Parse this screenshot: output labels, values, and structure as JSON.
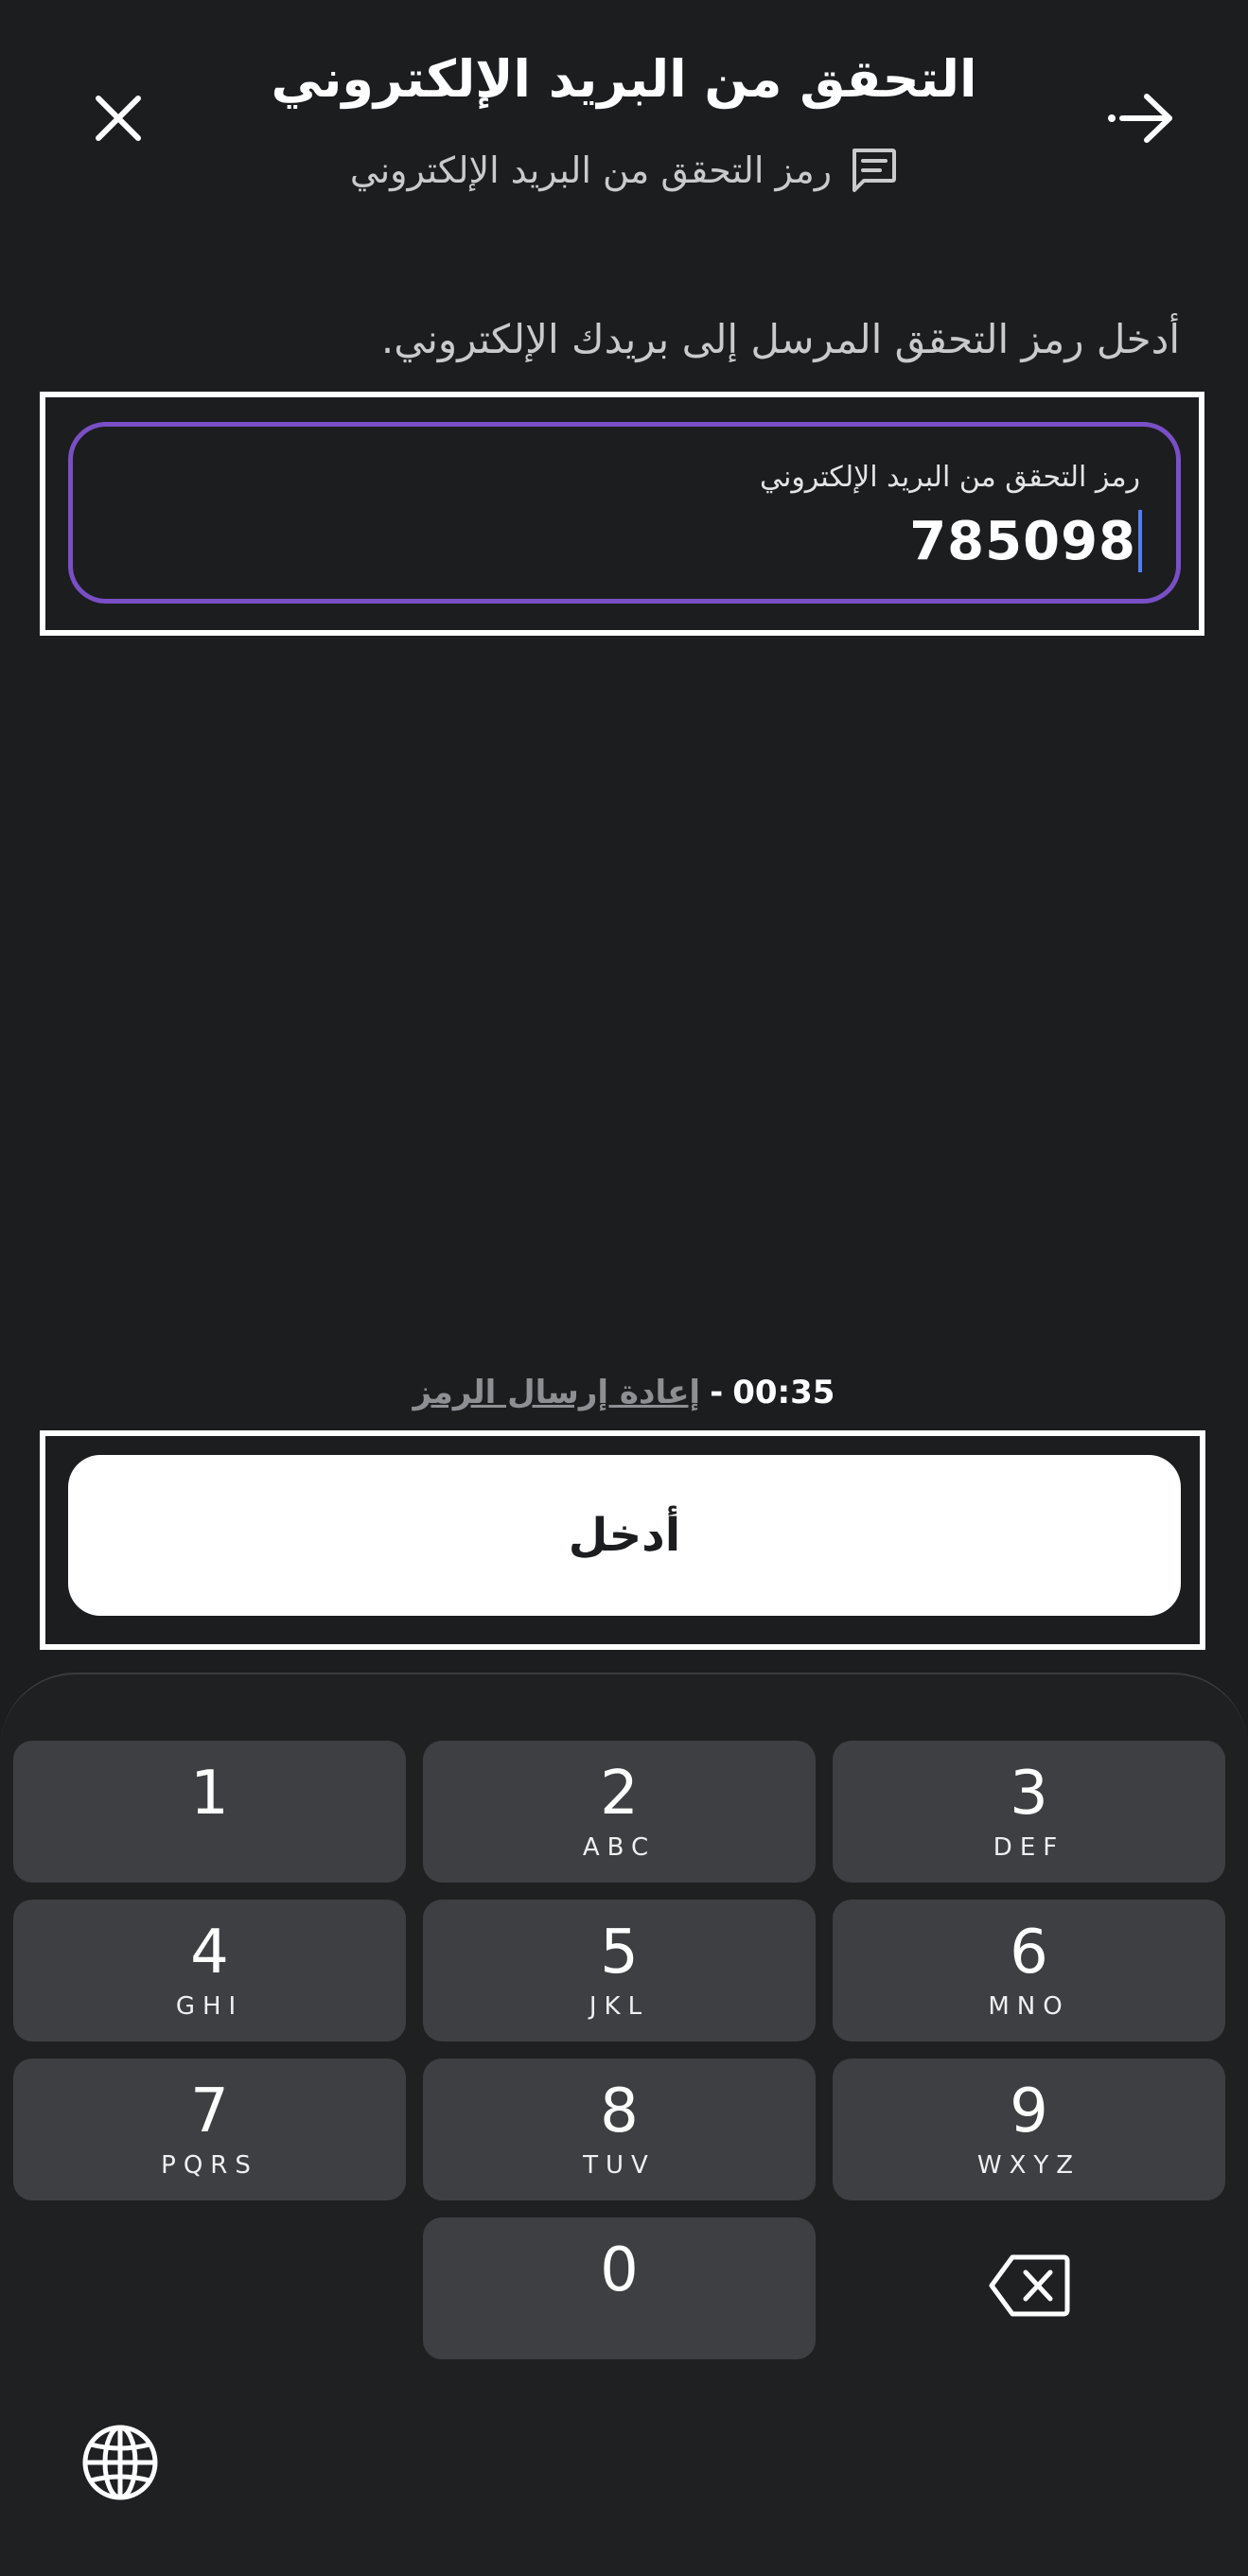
{
  "header": {
    "title": "التحقق من البريد الإلكتروني",
    "subtitle": "رمز التحقق من البريد الإلكتروني",
    "close_icon": "close-icon",
    "back_icon": "arrow-right-icon",
    "subtitle_icon": "message-icon"
  },
  "form": {
    "instruction": "أدخل رمز التحقق المرسل إلى بريدك الإلكتروني.",
    "field_label": "رمز التحقق من البريد الإلكتروني",
    "field_value": "785098"
  },
  "resend": {
    "timer": "00:35",
    "separator": "-",
    "link_label": "إعادة إرسال الرمز"
  },
  "enter_button": {
    "label": "أدخل"
  },
  "keypad": {
    "keys": [
      {
        "num": "1",
        "letters": ""
      },
      {
        "num": "2",
        "letters": "ABC"
      },
      {
        "num": "3",
        "letters": "DEF"
      },
      {
        "num": "4",
        "letters": "GHI"
      },
      {
        "num": "5",
        "letters": "JKL"
      },
      {
        "num": "6",
        "letters": "MNO"
      },
      {
        "num": "7",
        "letters": "PQRS"
      },
      {
        "num": "8",
        "letters": "TUV"
      },
      {
        "num": "9",
        "letters": "WXYZ"
      },
      {
        "num": "0",
        "letters": ""
      }
    ],
    "backspace_icon": "backspace-icon",
    "globe_icon": "globe-icon"
  },
  "colors": {
    "background": "#1c1d1f",
    "field_border": "#7a4fc6",
    "caret": "#4f7ff0",
    "key": "#3e3f42",
    "button": "#ffffff"
  }
}
